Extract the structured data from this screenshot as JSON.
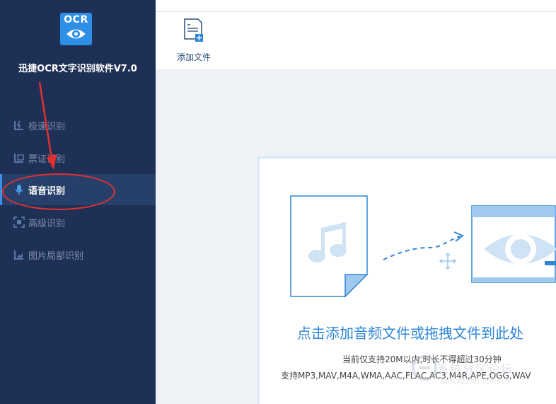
{
  "app": {
    "logo_text": "OCR",
    "title": "迅捷OCR文字识别软件V7.0"
  },
  "sidebar": {
    "items": [
      {
        "label": "极速识别",
        "icon": "fast-recognition-icon",
        "active": false
      },
      {
        "label": "票证识别",
        "icon": "ticket-recognition-icon",
        "active": false
      },
      {
        "label": "语音识别",
        "icon": "microphone-icon",
        "active": true
      },
      {
        "label": "高级识别",
        "icon": "advanced-recognition-icon",
        "active": false
      },
      {
        "label": "图片局部识别",
        "icon": "partial-image-icon",
        "active": false
      }
    ]
  },
  "toolbar": {
    "add_file_label": "添加文件",
    "add_file_icon": "add-file-icon"
  },
  "dropzone": {
    "title": "点击添加音频文件或拖拽文件到此处",
    "limit_text": "当前仅支持20M以内,时长不得超过30分钟",
    "formats_text": "支持MP3,MAV,M4A,WMA,AAC,FLAC,AC3,M4R,APE,OGG,WAV"
  },
  "watermark": {
    "text": "系统分区论坛",
    "sub": "bbs.xpzxh.com.cn"
  },
  "colors": {
    "sidebar_bg": "#1e3056",
    "active_bg": "#26406a",
    "accent": "#2f86d6",
    "annotation": "#e3302f"
  }
}
